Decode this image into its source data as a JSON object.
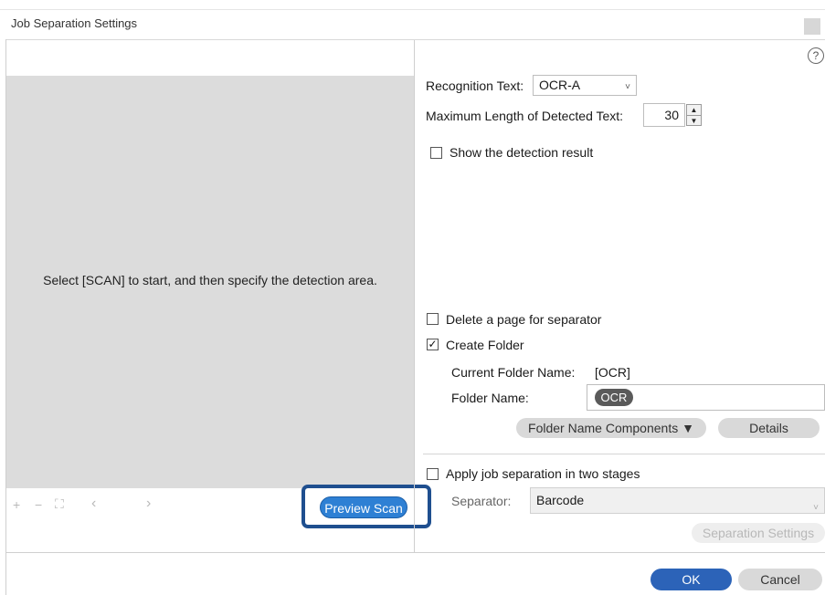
{
  "window": {
    "title": "Job Separation Settings"
  },
  "preview": {
    "message": "Select [SCAN] to start, and then specify the detection area.",
    "toolbar": {
      "zoom_in_icon": "+",
      "zoom_out_icon": "−",
      "fit_icon": "⛶",
      "prev_icon": "‹",
      "next_icon": "›"
    },
    "preview_scan_label": "Preview Scan"
  },
  "help_icon": "?",
  "recognition": {
    "label": "Recognition Text:",
    "value": "OCR-A",
    "chevron": "˅"
  },
  "max_length": {
    "label": "Maximum Length of Detected Text:",
    "value": "30",
    "up": "▲",
    "down": "▼"
  },
  "show_detection": {
    "label": "Show the detection result",
    "checked": false
  },
  "delete_page": {
    "label": "Delete a page for separator",
    "checked": false
  },
  "create_folder": {
    "label": "Create Folder",
    "checked": true,
    "check_glyph": "✓"
  },
  "current_folder": {
    "label": "Current Folder Name:",
    "value": "[OCR]"
  },
  "folder_name": {
    "label": "Folder Name:",
    "chip": "OCR"
  },
  "folder_name_components_label": "Folder Name Components ▼",
  "details_label": "Details",
  "two_stage": {
    "label": "Apply job separation in two stages",
    "checked": false
  },
  "separator": {
    "label": "Separator:",
    "value": "Barcode",
    "chevron": "˅"
  },
  "separation_settings_label": "Separation Settings",
  "ok_label": "OK",
  "cancel_label": "Cancel"
}
